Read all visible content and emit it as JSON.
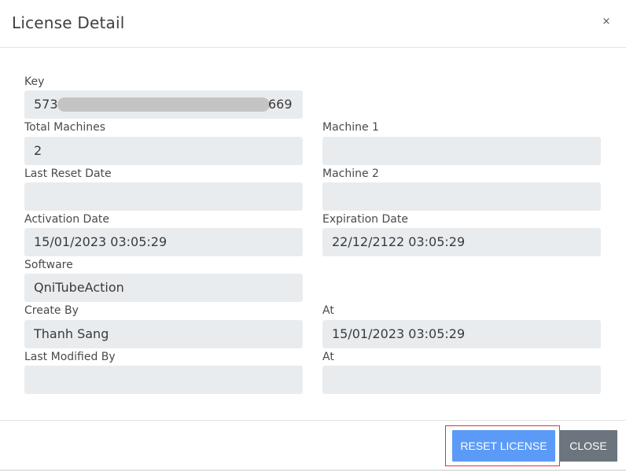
{
  "dialog": {
    "title": "License Detail",
    "close_symbol": "×"
  },
  "fields": {
    "key": {
      "label": "Key",
      "value_prefix": "573",
      "value_suffix": "669"
    },
    "total_machines": {
      "label": "Total Machines",
      "value": "2"
    },
    "machine1": {
      "label": "Machine 1",
      "value": ""
    },
    "last_reset_date": {
      "label": "Last Reset Date",
      "value": ""
    },
    "machine2": {
      "label": "Machine 2",
      "value": ""
    },
    "activation_date": {
      "label": "Activation Date",
      "value": "15/01/2023 03:05:29"
    },
    "expiration_date": {
      "label": "Expiration Date",
      "value": "22/12/2122 03:05:29"
    },
    "software": {
      "label": "Software",
      "value": "QniTubeAction"
    },
    "create_by": {
      "label": "Create By",
      "value": "Thanh Sang"
    },
    "create_at": {
      "label": "At",
      "value": "15/01/2023 03:05:29"
    },
    "last_modified_by": {
      "label": "Last Modified By",
      "value": ""
    },
    "modified_at": {
      "label": "At",
      "value": ""
    }
  },
  "footer": {
    "reset_label": "RESET LICENSE",
    "close_label": "CLOSE"
  },
  "colors": {
    "reset_button": "#5b9bf7",
    "close_button": "#6c757d",
    "highlight_border": "#d9343f",
    "field_background": "#e9ecef"
  }
}
